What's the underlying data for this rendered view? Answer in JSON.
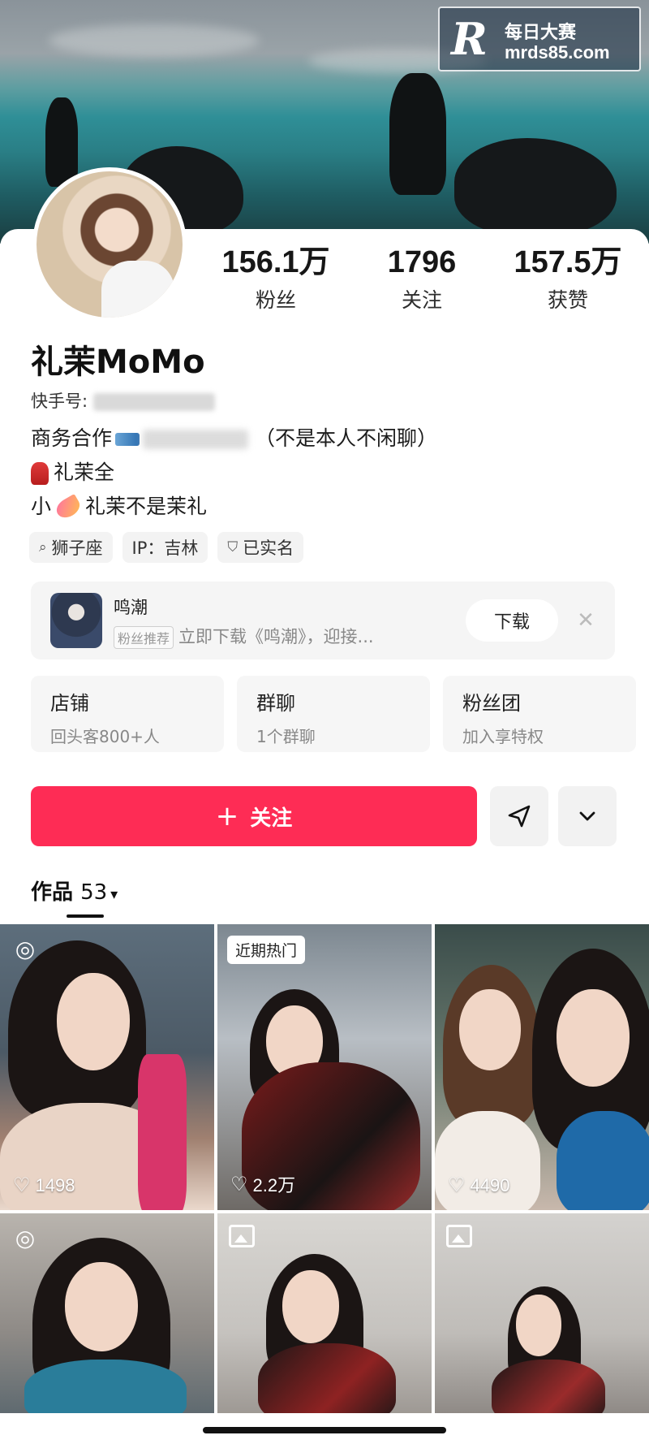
{
  "watermark": {
    "title": "每日大赛",
    "url": "mrds85.com",
    "logo": "R"
  },
  "profile": {
    "name": "礼茉MoMo",
    "kuaishou_id_label": "快手号:",
    "stats": [
      {
        "value": "156.1万",
        "label": "粉丝"
      },
      {
        "value": "1796",
        "label": "关注"
      },
      {
        "value": "157.5万",
        "label": "获赞"
      }
    ],
    "bio": {
      "line1_prefix": "商务合作",
      "line1_suffix": "（不是本人不闲聊）",
      "line2": "礼茉全",
      "line3_prefix": "小",
      "line3_suffix": "礼茉不是茉礼"
    },
    "tags": [
      {
        "icon": "search-icon",
        "label": "狮子座"
      },
      {
        "icon": "",
        "label": "IP：吉林"
      },
      {
        "icon": "shield-check-icon",
        "label": "已实名"
      }
    ]
  },
  "ad": {
    "title": "鸣潮",
    "badge": "粉丝推荐",
    "text": "立即下载《鸣潮》，迎接...",
    "download_label": "下载",
    "close_glyph": "✕"
  },
  "shortcuts": [
    {
      "title": "店铺",
      "subtitle": "回头客800+人"
    },
    {
      "title": "群聊",
      "subtitle": "1个群聊"
    },
    {
      "title": "粉丝团",
      "subtitle": "加入享特权"
    }
  ],
  "actions": {
    "follow_plus": "+",
    "follow_label": "关注"
  },
  "works": {
    "label": "作品",
    "count": "53",
    "caret": "▾",
    "items": [
      {
        "badge_type": "live",
        "badge_glyph": "◎",
        "likes": "1498"
      },
      {
        "badge_type": "hot",
        "badge_text": "近期热门",
        "likes": "2.2万"
      },
      {
        "badge_type": "none",
        "likes": "4490"
      },
      {
        "badge_type": "live",
        "badge_glyph": "◎",
        "likes": ""
      },
      {
        "badge_type": "image",
        "likes": ""
      },
      {
        "badge_type": "image",
        "likes": ""
      }
    ],
    "heart_glyph": "♡"
  },
  "colors": {
    "accent": "#fe2c55"
  }
}
